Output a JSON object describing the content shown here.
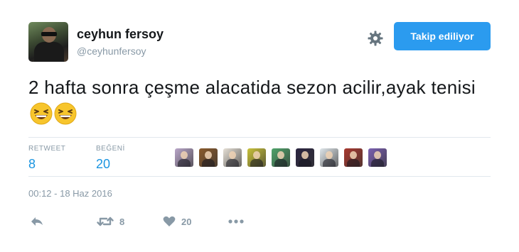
{
  "user": {
    "name": "ceyhun fersoy",
    "handle": "@ceyhunfersoy"
  },
  "follow_button": {
    "label": "Takip ediliyor",
    "color": "#2b9bef"
  },
  "tweet": {
    "text": "2 hafta sonra çeşme alacatida sezon acilir,ayak tenisi",
    "emojis": [
      "grinning-squinting-face",
      "grinning-squinting-face"
    ]
  },
  "stats": {
    "retweet_label": "RETWEET",
    "retweet_count": "8",
    "like_label": "BEĞENİ",
    "like_count": "20"
  },
  "likers": [
    {
      "name": "liker-avatar-1",
      "color": "#b9a6c9"
    },
    {
      "name": "liker-avatar-2",
      "color": "#8a5a2b"
    },
    {
      "name": "liker-avatar-3",
      "color": "#e6e0d6"
    },
    {
      "name": "liker-avatar-4",
      "color": "#c9c23a"
    },
    {
      "name": "liker-avatar-5",
      "color": "#4fa36a"
    },
    {
      "name": "liker-avatar-6",
      "color": "#2a2440"
    },
    {
      "name": "liker-avatar-7",
      "color": "#dfe6ea"
    },
    {
      "name": "liker-avatar-8",
      "color": "#a8382e"
    },
    {
      "name": "liker-avatar-9",
      "color": "#7a5fb0"
    }
  ],
  "timestamp": "00:12 - 18 Haz 2016",
  "actions": {
    "reply_icon": "reply-icon",
    "retweet_icon": "retweet-icon",
    "retweet_count": "8",
    "like_icon": "heart-icon",
    "like_count": "20",
    "more_icon": "more-icon"
  },
  "colors": {
    "accent": "#1b95e0",
    "muted": "#8899a6",
    "divider": "#e1e8ed"
  }
}
